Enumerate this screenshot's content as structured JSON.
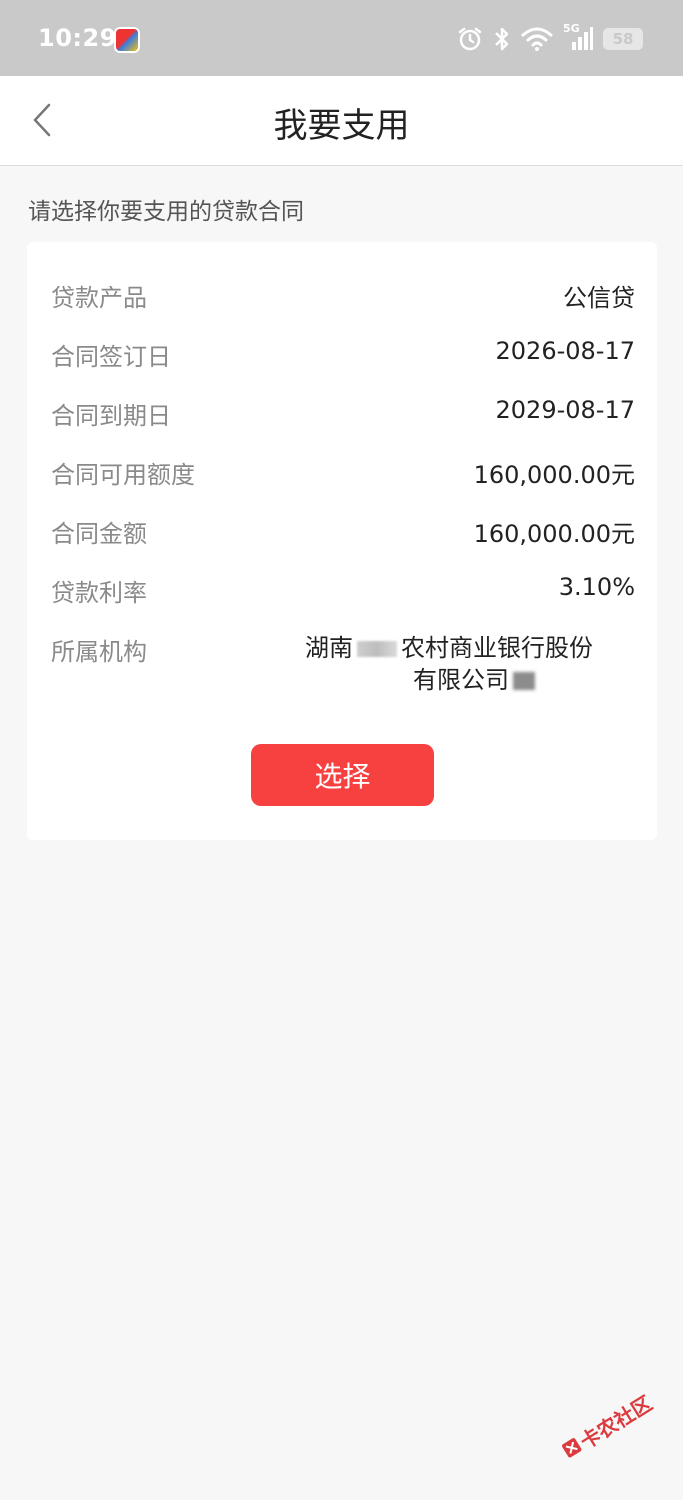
{
  "status_bar": {
    "time": "10:29",
    "battery": "58",
    "network": "5G"
  },
  "header": {
    "title": "我要支用"
  },
  "section_hint": "请选择你要支用的贷款合同",
  "contract": {
    "rows": [
      {
        "label": "贷款产品",
        "value": "公信贷"
      },
      {
        "label": "合同签订日",
        "value": "2026-08-17"
      },
      {
        "label": "合同到期日",
        "value": "2029-08-17"
      },
      {
        "label": "合同可用额度",
        "value": "160,000.00元"
      },
      {
        "label": "合同金额",
        "value": "160,000.00元"
      },
      {
        "label": "贷款利率",
        "value": "3.10%"
      }
    ],
    "org_label": "所属机构",
    "org_value_part1": "湖南",
    "org_value_part2": "农村商业银行股份",
    "org_value_part3": "有限公司"
  },
  "select_button": "选择",
  "watermark": "卡农社区",
  "colors": {
    "accent": "#f74040",
    "status_bar_bg": "#c9c9c9",
    "page_bg": "#f7f7f7",
    "watermark": "#d8262c"
  }
}
